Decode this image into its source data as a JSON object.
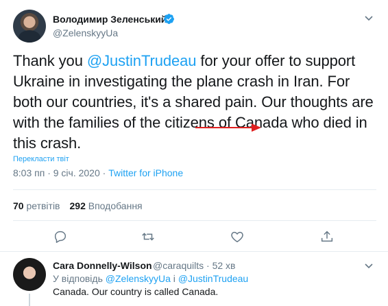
{
  "author": {
    "name": "Володимир Зеленський",
    "handle": "@ZelenskyyUa"
  },
  "tweet": {
    "text_part1": "Thank you ",
    "mention": "@JustinTrudeau",
    "text_part2": " for your offer to support Ukraine in investigating the plane crash in Iran. For both our countries, it's a shared pain. Our thoughts are with the families of the citizens of Canada who died in this crash.",
    "translate_label": "Перекласти твіт",
    "time": "8:03 пп · 9 січ. 2020 · ",
    "source": "Twitter for iPhone"
  },
  "stats": {
    "retweets_count": "70",
    "retweets_label": "ретвітів",
    "likes_count": "292",
    "likes_label": "Вподобання"
  },
  "actions": {
    "reply_icon": "reply-icon",
    "retweet_icon": "retweet-icon",
    "like_icon": "heart-icon",
    "share_icon": "share-icon"
  },
  "reply": {
    "name": "Cara Donnelly-Wilson",
    "handle_time": "@caraquilts · 52 хв",
    "reply_prefix": "У відповідь ",
    "reply_mention1": "@ZelenskyyUa",
    "reply_and": " і ",
    "reply_mention2": "@JustinTrudeau",
    "text": "Canada. Our country is called Canada."
  },
  "colors": {
    "accent": "#1da1f2",
    "muted": "#657786",
    "annotation_arrow": "#e02020"
  }
}
